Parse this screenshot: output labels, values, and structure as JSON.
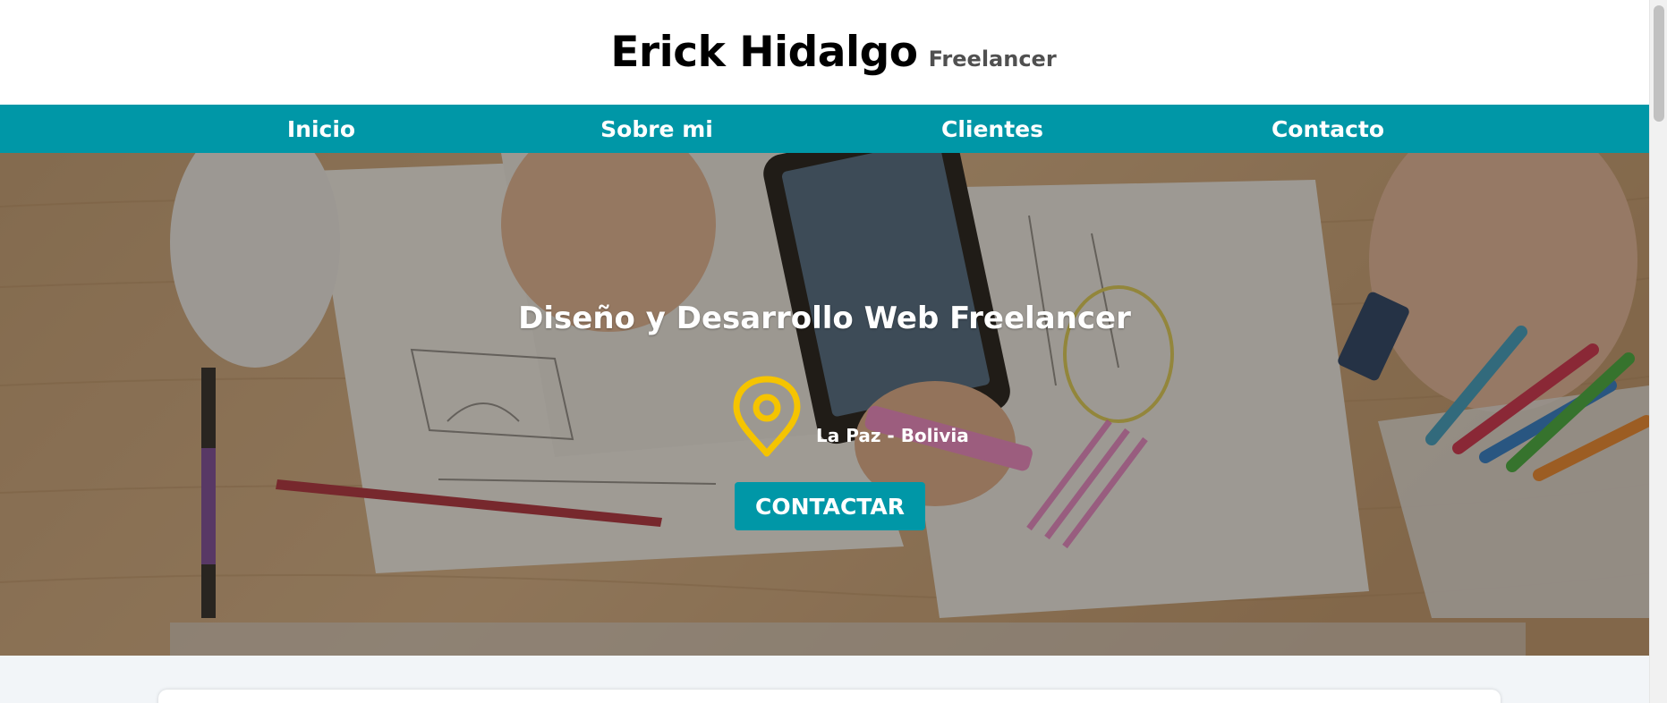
{
  "header": {
    "brand_name": "Erick Hidalgo",
    "brand_tagline": "Freelancer"
  },
  "nav": {
    "items": [
      {
        "label": "Inicio"
      },
      {
        "label": "Sobre mi"
      },
      {
        "label": "Clientes"
      },
      {
        "label": "Contacto"
      }
    ]
  },
  "hero": {
    "title": "Diseño y Desarrollo Web Freelancer",
    "location_icon": "map-pin-icon",
    "location_text": "La Paz - Bolivia",
    "cta_label": "CONTACTAR"
  },
  "colors": {
    "accent": "#0097a7",
    "location_icon": "#f5c400",
    "below_background": "#f2f5f8"
  }
}
